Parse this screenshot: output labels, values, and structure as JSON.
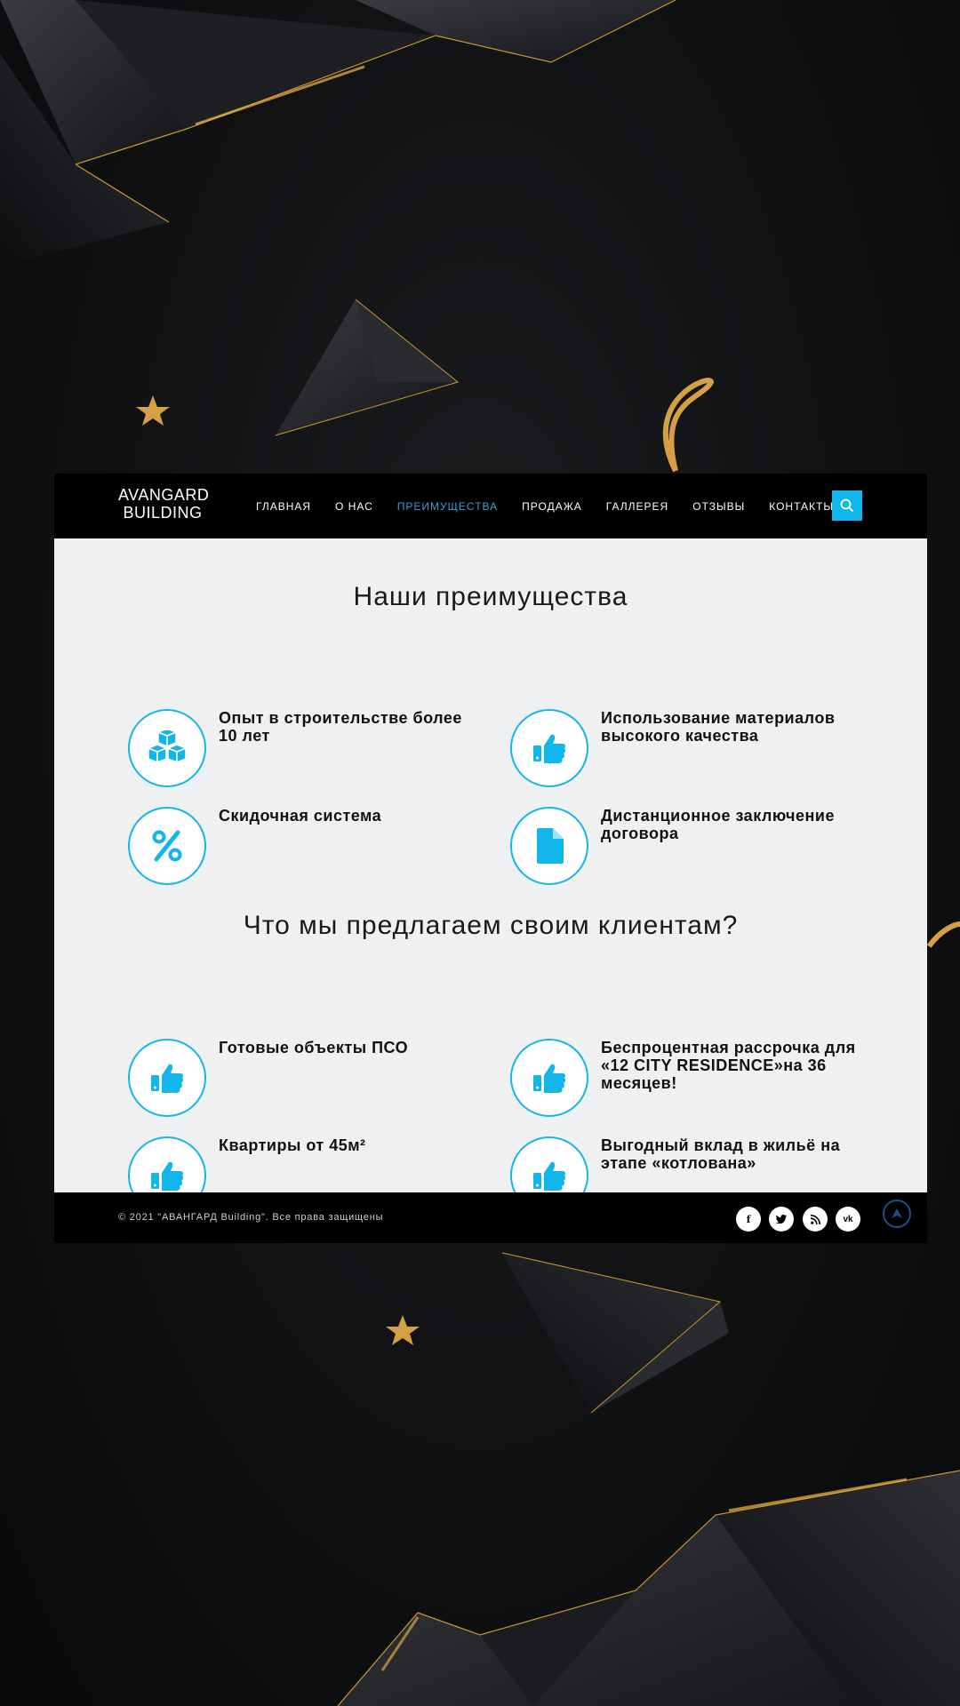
{
  "brand": {
    "line1": "AVANGARD",
    "line2": "BUILDING"
  },
  "nav": {
    "items": [
      {
        "label": "ГЛАВНАЯ"
      },
      {
        "label": "О НАС"
      },
      {
        "label": "ПРЕИМУЩЕСТВА",
        "active": true
      },
      {
        "label": "ПРОДАЖА"
      },
      {
        "label": "ГАЛЛЕРЕЯ"
      },
      {
        "label": "ОТЗЫВЫ"
      },
      {
        "label": "КОНТАКТЫ"
      }
    ],
    "search_icon": "search-icon"
  },
  "advantages": {
    "title": "Наши преимущества",
    "items": [
      {
        "icon": "cubes-icon",
        "text": "Опыт в строительстве более 10 лет"
      },
      {
        "icon": "thumbs-up-icon",
        "text": "Использование материалов высокого качества"
      },
      {
        "icon": "percent-icon",
        "text": "Скидочная система"
      },
      {
        "icon": "document-icon",
        "text": "Дистанционное заключение договора"
      }
    ]
  },
  "offers": {
    "title": "Что мы предлагаем своим клиентам?",
    "items": [
      {
        "icon": "thumbs-up-icon",
        "text": "Готовые объекты ПСО"
      },
      {
        "icon": "thumbs-up-icon",
        "text": "Беспроцентная рассрочка для «12 CITY RESIDENCE»на 36 месяцев!"
      },
      {
        "icon": "thumbs-up-icon",
        "text": "Квартиры от 45м²"
      },
      {
        "icon": "thumbs-up-icon",
        "text": "Выгодный вклад в жильё на этапе «котлована»"
      }
    ]
  },
  "footer": {
    "copyright": "© 2021 \"АВАНГАРД Building\". Все права защищены",
    "social": [
      {
        "icon": "facebook-icon",
        "glyph": "f"
      },
      {
        "icon": "twitter-icon",
        "glyph": "t"
      },
      {
        "icon": "rss-icon",
        "glyph": "rss"
      },
      {
        "icon": "vk-icon",
        "glyph": "vk"
      }
    ],
    "back_to_top_icon": "arrow-up-icon"
  },
  "colors": {
    "accent": "#13b6ea",
    "active_nav": "#3d9bdc",
    "gold": "#d4a043",
    "background": "#111214"
  }
}
